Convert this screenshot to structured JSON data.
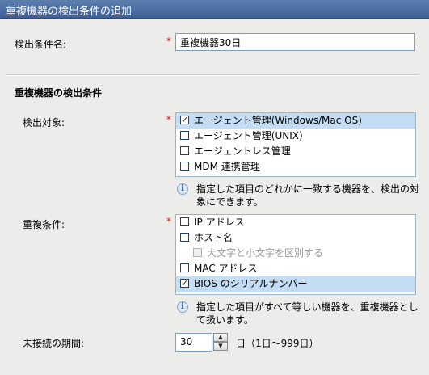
{
  "dialog": {
    "title": "重複機器の検出条件の追加"
  },
  "name_field": {
    "label": "検出条件名:",
    "required_mark": "*",
    "value": "重複機器30日"
  },
  "section": {
    "title": "重複機器の検出条件"
  },
  "target": {
    "label": "検出対象:",
    "required_mark": "*",
    "items": [
      {
        "label": "エージェント管理(Windows/Mac OS)",
        "checked": true,
        "check": "✓"
      },
      {
        "label": "エージェント管理(UNIX)",
        "checked": false,
        "check": ""
      },
      {
        "label": "エージェントレス管理",
        "checked": false,
        "check": ""
      },
      {
        "label": "MDM 連携管理",
        "checked": false,
        "check": ""
      }
    ],
    "hint_icon": "info-icon",
    "hint": "指定した項目のどれかに一致する機器を、検出の対象にできます。"
  },
  "condition": {
    "label": "重複条件:",
    "required_mark": "*",
    "items": [
      {
        "label": "IP アドレス",
        "checked": false,
        "check": ""
      },
      {
        "label": "ホスト名",
        "checked": false,
        "check": ""
      },
      {
        "label": "大文字と小文字を区別する",
        "checked": false,
        "disabled": true,
        "check": ""
      },
      {
        "label": "MAC アドレス",
        "checked": false,
        "check": ""
      },
      {
        "label": "BIOS のシリアルナンバー",
        "checked": true,
        "check": "✓"
      }
    ],
    "hint_icon": "info-icon",
    "hint": "指定した項目がすべて等しい機器を、重複機器として扱います。"
  },
  "period": {
    "label": "未接続の期間:",
    "value": "30",
    "unit": "日（1日～999日）",
    "up": "▲",
    "down": "▼"
  },
  "info_glyph": "i"
}
